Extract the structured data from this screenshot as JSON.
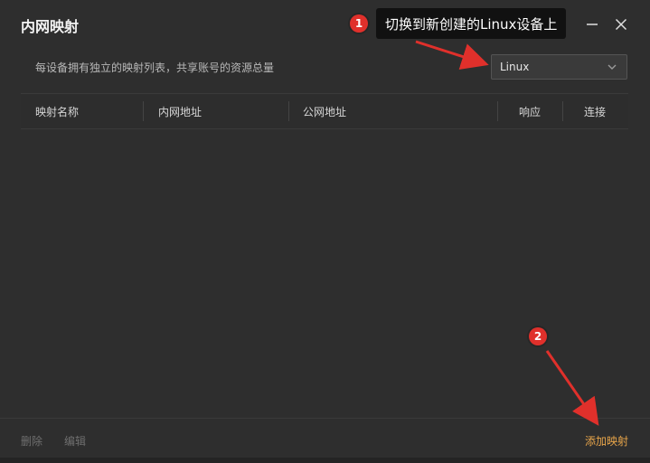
{
  "window": {
    "title": "内网映射"
  },
  "description": "每设备拥有独立的映射列表，共享账号的资源总量",
  "device_select": {
    "selected": "Linux"
  },
  "table": {
    "columns": [
      "映射名称",
      "内网地址",
      "公网地址",
      "响应",
      "连接"
    ]
  },
  "footer": {
    "delete_label": "删除",
    "edit_label": "编辑",
    "add_label": "添加映射"
  },
  "annotations": {
    "step1_number": "1",
    "step1_text": "切换到新创建的Linux设备上",
    "step2_number": "2"
  },
  "colors": {
    "accent": "#e8a54a",
    "annotation_red": "#e0302b",
    "background": "#2e2e2e"
  },
  "icons": {
    "minimize": "minimize-icon",
    "close": "close-icon",
    "dropdown": "chevron-down-icon"
  }
}
